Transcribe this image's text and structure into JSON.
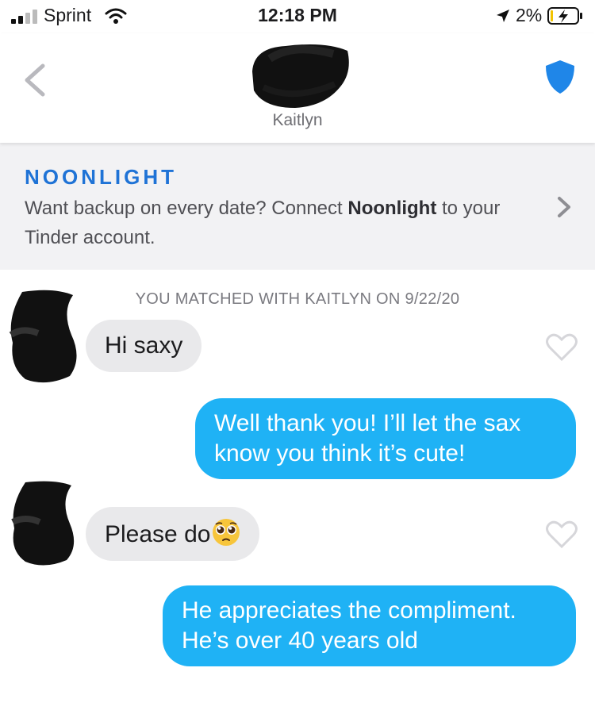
{
  "status_bar": {
    "carrier": "Sprint",
    "time": "12:18 PM",
    "battery": "2%"
  },
  "header": {
    "match_name": "Kaitlyn"
  },
  "banner": {
    "brand": "NOONLIGHT",
    "text_before": "Want backup on every date? Connect ",
    "text_bold": "Noonlight",
    "text_after": " to your Tinder account."
  },
  "chat": {
    "matched_label": "YOU MATCHED WITH KAITLYN ON 9/22/20",
    "messages": [
      {
        "sender": "them",
        "text": "Hi saxy"
      },
      {
        "sender": "me",
        "text": "Well thank you! I’ll let the sax know you think it’s cute!"
      },
      {
        "sender": "them",
        "text": "Please do",
        "emoji": "pleading-face-emoji"
      },
      {
        "sender": "me",
        "text": "He appreciates the compliment. He’s over 40 years old"
      }
    ]
  },
  "colors": {
    "outgoing_bubble": "#1fb2f5",
    "incoming_bubble": "#e9e9eb",
    "shield": "#1f86e8",
    "brand": "#1f73d6"
  }
}
